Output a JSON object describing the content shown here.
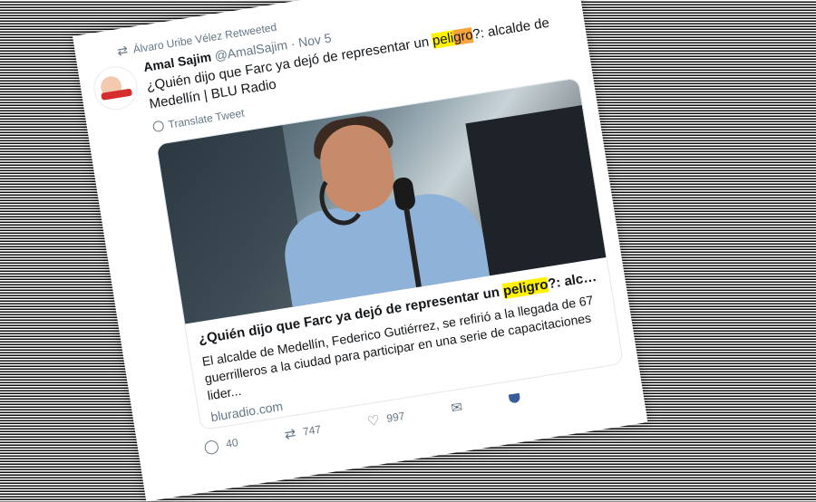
{
  "retweet": {
    "text": "Álvaro Uribe Vélez Retweeted"
  },
  "tweet": {
    "name": "Amal Sajim",
    "handle": "@AmalSajim",
    "separator": "·",
    "date": "Nov 5",
    "text_before": "¿Quién dijo que Farc ya dejó de representar un ",
    "highlight_a": "peli",
    "highlight_b": "gro",
    "text_after": "?: alcalde de Medellín | BLU Radio",
    "translate_label": "Translate Tweet"
  },
  "link_card": {
    "title_before": "¿Quién dijo que Farc ya dejó de representar un ",
    "title_highlight": "peligro",
    "title_after": "?: alcalde de ...",
    "description": "El alcalde de Medellín, Federico Gutiérrez, se refirió a la llegada de 67 guerrilleros a la ciudad para participar en una serie de capacitaciones lider...",
    "domain": "bluradio.com"
  },
  "actions": {
    "replies": "40",
    "retweets": "747",
    "likes": "997"
  },
  "colors": {
    "highlight_yellow": "#fff200",
    "highlight_orange": "#f7a53a",
    "secondary_text": "#657786"
  }
}
